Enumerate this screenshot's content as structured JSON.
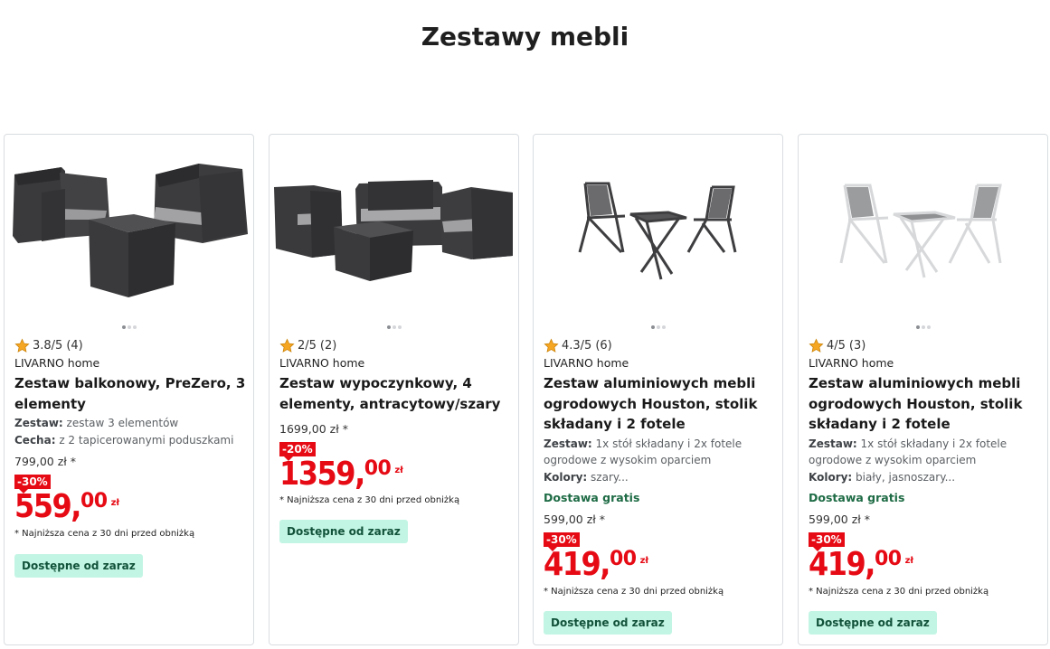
{
  "page": {
    "title": "Zestawy mebli"
  },
  "colors": {
    "price_red": "#e60a14",
    "badge_green_bg": "#c3f5e4",
    "shipping_green": "#1e6b45",
    "star": "#f5a623"
  },
  "icons": {
    "rating": "star-icon"
  },
  "products": [
    {
      "rating": "3.8/5",
      "reviews": "(4)",
      "brand": "LIVARNO home",
      "title": "Zestaw balkonowy, PreZero, 3 elementy",
      "attr1_label": "Zestaw:",
      "attr1_value": " zestaw 3 elementów",
      "attr2_label": "Cecha:",
      "attr2_value": " z 2 tapicerowanymi poduszkami",
      "old_price": "799,00 zł *",
      "discount": "-30%",
      "price_whole": "559,",
      "price_dec": "00",
      "currency": "zł",
      "note": "* Najniższa cena z 30 dni przed obniżką",
      "availability": "Dostępne od zaraz"
    },
    {
      "rating": "2/5",
      "reviews": "(2)",
      "brand": "LIVARNO home",
      "title": "Zestaw wypoczynkowy, 4 elementy, antracytowy/szary",
      "old_price": "1699,00 zł *",
      "discount": "-20%",
      "price_whole": "1359,",
      "price_dec": "00",
      "currency": "zł",
      "note": "* Najniższa cena z 30 dni przed obniżką",
      "availability": "Dostępne od zaraz"
    },
    {
      "rating": "4.3/5",
      "reviews": "(6)",
      "brand": "LIVARNO home",
      "title": "Zestaw aluminiowych mebli ogrodowych Houston, stolik składany i 2 fotele",
      "attr1_label": "Zestaw:",
      "attr1_value": " 1x stół składany i 2x fotele ogrodowe z wysokim oparciem",
      "attr2_label": "Kolory:",
      "attr2_value": " szary...",
      "shipping": "Dostawa gratis",
      "old_price": "599,00 zł *",
      "discount": "-30%",
      "price_whole": "419,",
      "price_dec": "00",
      "currency": "zł",
      "note": "* Najniższa cena z 30 dni przed obniżką",
      "availability": "Dostępne od zaraz"
    },
    {
      "rating": "4/5",
      "reviews": "(3)",
      "brand": "LIVARNO home",
      "title": "Zestaw aluminiowych mebli ogrodowych Houston, stolik składany i 2 fotele",
      "attr1_label": "Zestaw:",
      "attr1_value": " 1x stół składany i 2x fotele ogrodowe z wysokim oparciem",
      "attr2_label": "Kolory:",
      "attr2_value": " biały, jasnoszary...",
      "shipping": "Dostawa gratis",
      "old_price": "599,00 zł *",
      "discount": "-30%",
      "price_whole": "419,",
      "price_dec": "00",
      "currency": "zł",
      "note": "* Najniższa cena z 30 dni przed obniżką",
      "availability": "Dostępne od zaraz"
    }
  ]
}
